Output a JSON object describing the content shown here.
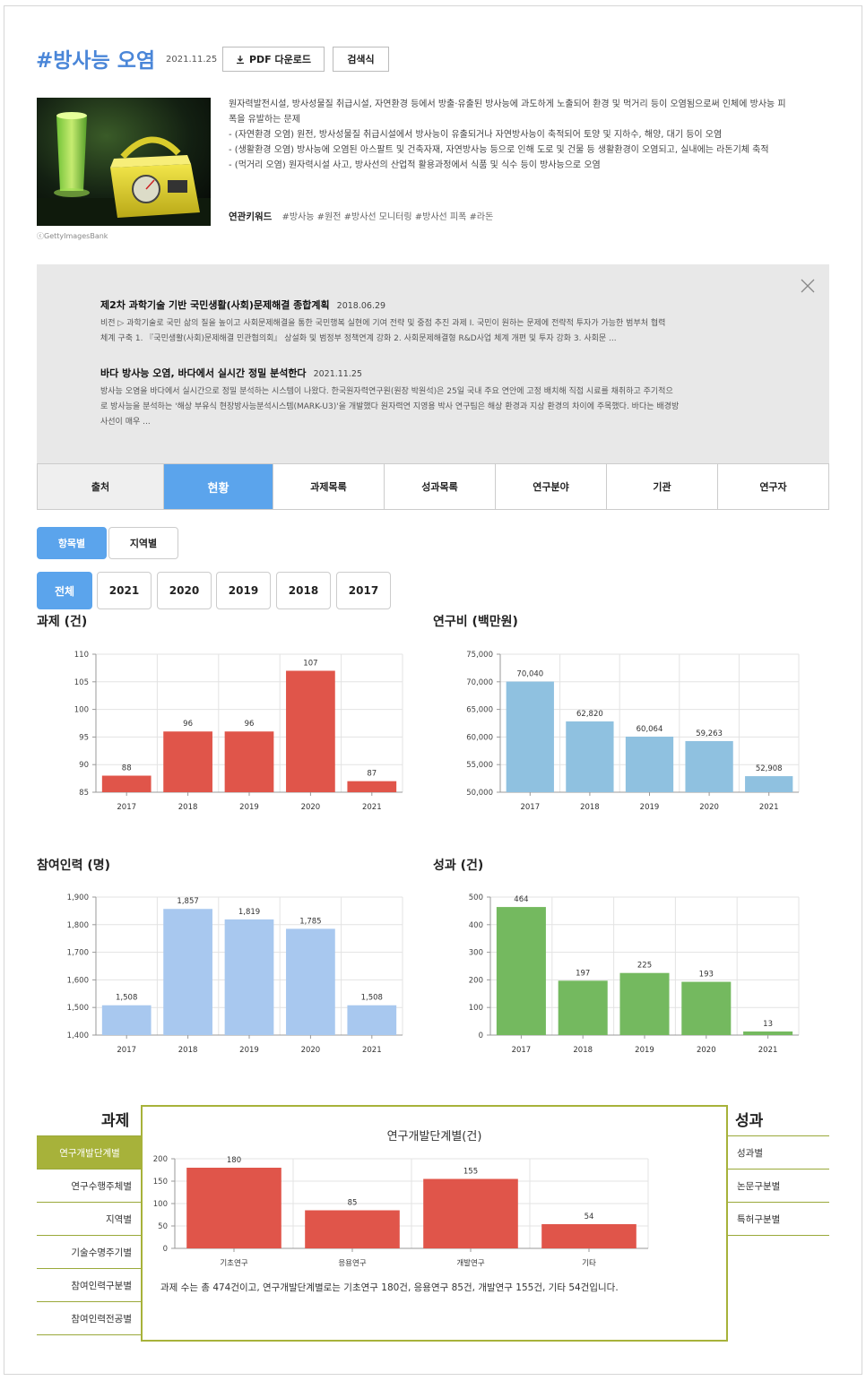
{
  "header": {
    "title": "#방사능 오염",
    "date": "2021.11.25",
    "pdf_button": "PDF 다운로드",
    "query_button": "검색식"
  },
  "image": {
    "credit": "ⓒGettyImagesBank"
  },
  "description": [
    "원자력발전시설, 방사성물질 취급시설, 자연환경 등에서 방출·유출된 방사능에 과도하게 노출되어 환경 및 먹거리 등이 오염됨으로써 인체에 방사능 피폭을 유발하는 문제",
    "- (자연환경 오염) 원전, 방사성물질 취급시설에서 방사능이 유출되거나 자연방사능이 축적되어 토양 및 지하수, 해양, 대기 등이 오염",
    "- (생활환경 오염) 방사능에 오염된 아스팔트 및 건축자재, 자연방사능 등으로 인해 도로 및 건물 등 생활환경이 오염되고, 실내에는 라돈기체 축적",
    "- (먹거리 오염) 원자력시설 사고, 방사선의 산업적 활용과정에서 식품 및 식수 등이 방사능으로 오염"
  ],
  "keywords": {
    "label": "연관키워드",
    "items": "#방사능 #원전 #방사선 모니터링 #방사선 피폭 #라돈"
  },
  "news": [
    {
      "title": "제2차 과학기술 기반 국민생활(사회)문제해결 종합계획",
      "date": "2018.06.29",
      "line1": "비전 ▷ 과학기술로 국민 삶의 질을 높이고 사회문제해결을 통한 국민행복 실현에 기여 전략 및 중점 추진 과제 Ⅰ. 국민이 원하는 문제에 전략적 투자가 가능한 범부처 협력",
      "line2": "체계 구축 1. 『국민생활(사회)문제해결 민관협의회』 상설화 및 범정부 정책연계 강화 2. 사회문제해결형 R&D사업 체계 개편 및 투자 강화 3. 사회문 ..."
    },
    {
      "title": "바다 방사능 오염, 바다에서 실시간 정밀 분석한다",
      "date": "2021.11.25",
      "line1": "방사능 오염을 바다에서 실시간으로 정밀 분석하는 시스템이 나왔다. 한국원자력연구원(원장 박원석)은 25일 국내 주요 연안에 고정 배치해 직접 시료를 채취하고 주기적으",
      "line2": "로 방사능을 분석하는 '해상 부유식 현장방사능분석시스템(MARK-U3)'을 개발했다 원자력연 지영용 박사 연구팀은 해상 환경과 지상 환경의 차이에 주목했다. 바다는 배경방",
      "line3": "사선이 매우 ..."
    }
  ],
  "tabs": [
    "출처",
    "현황",
    "과제목록",
    "성과목록",
    "연구분야",
    "기관",
    "연구자"
  ],
  "view_toggle": [
    "항목별",
    "지역별"
  ],
  "year_filter": [
    "전체",
    "2021",
    "2020",
    "2019",
    "2018",
    "2017"
  ],
  "colors": {
    "red": "#e0554a",
    "steelblue": "#8fc1e0",
    "lightblue": "#a8c8ef",
    "green": "#74b95f",
    "olive": "#a7b23a",
    "accent": "#5ba4ec"
  },
  "chart_data": [
    {
      "type": "bar",
      "title": "과제 (건)",
      "categories": [
        "2017",
        "2018",
        "2019",
        "2020",
        "2021"
      ],
      "values": [
        88,
        96,
        96,
        107,
        87
      ],
      "labels": [
        "88",
        "96",
        "96",
        "107",
        "87"
      ],
      "yticks": [
        "85",
        "90",
        "95",
        "100",
        "105",
        "110"
      ],
      "ylim": [
        85,
        110
      ],
      "color": "#e0554a"
    },
    {
      "type": "bar",
      "title": "연구비 (백만원)",
      "categories": [
        "2017",
        "2018",
        "2019",
        "2020",
        "2021"
      ],
      "values": [
        70040,
        62820,
        60064,
        59263,
        52908
      ],
      "labels": [
        "70,040",
        "62,820",
        "60,064",
        "59,263",
        "52,908"
      ],
      "yticks": [
        "50,000",
        "55,000",
        "60,000",
        "65,000",
        "70,000",
        "75,000"
      ],
      "ylim": [
        50000,
        75000
      ],
      "color": "#8fc1e0"
    },
    {
      "type": "bar",
      "title": "참여인력 (명)",
      "categories": [
        "2017",
        "2018",
        "2019",
        "2020",
        "2021"
      ],
      "values": [
        1508,
        1857,
        1819,
        1785,
        1508
      ],
      "labels": [
        "1,508",
        "1,857",
        "1,819",
        "1,785",
        "1,508"
      ],
      "yticks": [
        "1,400",
        "1,500",
        "1,600",
        "1,700",
        "1,800",
        "1,900"
      ],
      "ylim": [
        1400,
        1900
      ],
      "color": "#a8c8ef"
    },
    {
      "type": "bar",
      "title": "성과 (건)",
      "categories": [
        "2017",
        "2018",
        "2019",
        "2020",
        "2021"
      ],
      "values": [
        464,
        197,
        225,
        193,
        13
      ],
      "labels": [
        "464",
        "197",
        "225",
        "193",
        "13"
      ],
      "yticks": [
        "0",
        "100",
        "200",
        "300",
        "400",
        "500"
      ],
      "ylim": [
        0,
        500
      ],
      "color": "#74b95f"
    },
    {
      "type": "bar",
      "title": "연구개발단계별(건)",
      "categories": [
        "기초연구",
        "응용연구",
        "개발연구",
        "기타"
      ],
      "values": [
        180,
        85,
        155,
        54
      ],
      "labels": [
        "180",
        "85",
        "155",
        "54"
      ],
      "yticks": [
        "0",
        "50",
        "100",
        "150",
        "200"
      ],
      "ylim": [
        0,
        200
      ],
      "color": "#e0554a"
    }
  ],
  "breakdown": {
    "left_head": "과제",
    "right_head": "성과",
    "left_items": [
      "연구개발단계별",
      "연구수행주체별",
      "지역별",
      "기술수명주기별",
      "참여인력구분별",
      "참여인력전공별"
    ],
    "right_items": [
      "성과별",
      "논문구분별",
      "특허구분별"
    ],
    "summary": "과제 수는 총 474건이고, 연구개발단계별로는 기초연구 180건, 응용연구 85건, 개발연구 155건, 기타 54건입니다."
  }
}
